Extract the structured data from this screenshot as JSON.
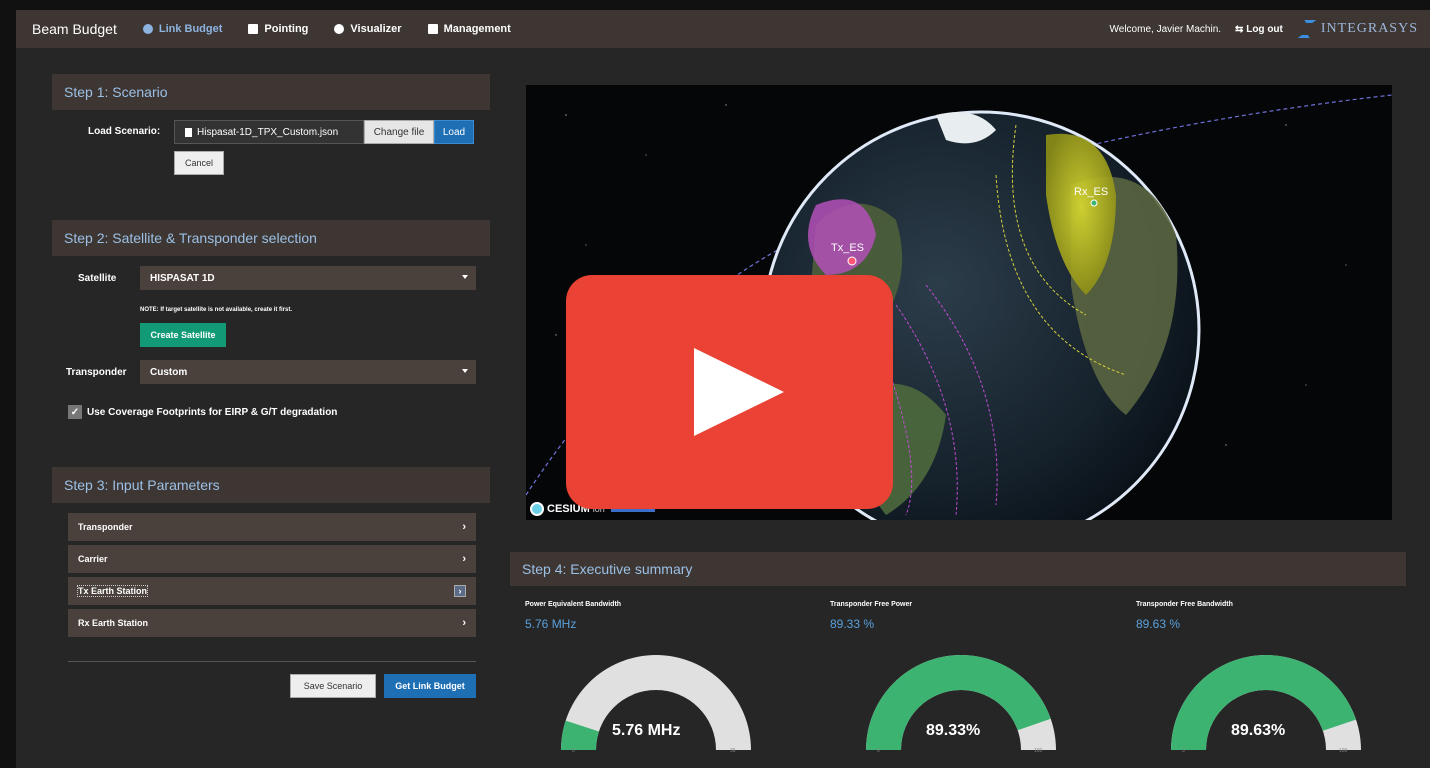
{
  "topbar": {
    "brand": "Beam Budget",
    "nav": [
      "Link Budget",
      "Pointing",
      "Visualizer",
      "Management"
    ],
    "welcome": "Welcome, Javier Machin.",
    "logout": "Log out",
    "logo": "INTEGRASYS"
  },
  "step1": {
    "title": "Step 1: Scenario",
    "load_label": "Load Scenario:",
    "file_name": "Hispasat-1D_TPX_Custom.json",
    "change_file": "Change file",
    "load": "Load",
    "cancel": "Cancel"
  },
  "step2": {
    "title": "Step 2: Satellite & Transponder selection",
    "satellite_label": "Satellite",
    "satellite_value": "HISPASAT 1D",
    "note": "NOTE: If target satellite is not available, create it first.",
    "create_satellite": "Create Satellite",
    "transponder_label": "Transponder",
    "transponder_value": "Custom",
    "coverage_check": "Use Coverage Footprints for EIRP & G/T degradation",
    "coverage_checked": true
  },
  "step3": {
    "title": "Step 3: Input Parameters",
    "sections": [
      "Transponder",
      "Carrier",
      "Tx Earth Station",
      "Rx Earth Station"
    ],
    "save_scenario": "Save Scenario",
    "get_link_budget": "Get Link Budget"
  },
  "viewer": {
    "tx_label": "Tx_ES",
    "rx_label": "Rx_ES",
    "attribution": "CESIUM",
    "attribution_ion": "ion"
  },
  "step4": {
    "title": "Step 4: Executive summary",
    "gauges": [
      {
        "title": "Power Equivalent Bandwidth",
        "value": "5.76 MHz",
        "label": "5.76 MHz",
        "fraction": 0.1,
        "min": "0",
        "max": "36"
      },
      {
        "title": "Transponder Free Power",
        "value": "89.33 %",
        "label": "89.33%",
        "fraction": 0.8933,
        "min": "0",
        "max": "100"
      },
      {
        "title": "Transponder Free Bandwidth",
        "value": "89.63 %",
        "label": "89.63%",
        "fraction": 0.8963,
        "min": "0",
        "max": "100"
      }
    ]
  },
  "colors": {
    "accent_blue": "#1f6fb5",
    "gauge_green": "#3cb371",
    "gauge_track": "#e0e0e0",
    "play_red": "#ea4335",
    "header_bg": "#3d3633"
  }
}
